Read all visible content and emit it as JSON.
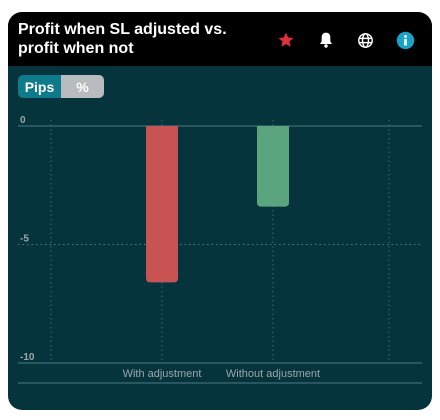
{
  "header": {
    "title": "Profit when SL adjusted vs. profit when not",
    "icons": [
      "star-icon",
      "bell-icon",
      "globe-icon",
      "info-icon"
    ]
  },
  "toggle": {
    "options": [
      {
        "label": "Pips",
        "active": true
      },
      {
        "label": "%",
        "active": false
      }
    ]
  },
  "colors": {
    "background": "#05343c",
    "header": "#000000",
    "star": "#e0303a",
    "info": "#1aa3c8",
    "toggle_active": "#0e7a8a",
    "toggle_inactive": "#b9bcbe"
  },
  "chart_data": {
    "type": "bar",
    "categories": [
      "With adjustment",
      "Without adjustment"
    ],
    "values": [
      -6.6,
      -3.4
    ],
    "colors": [
      "#c85353",
      "#5aa57e"
    ],
    "yticks": [
      0,
      -5,
      -10
    ],
    "ylim": [
      -10,
      0
    ],
    "grid": true
  }
}
